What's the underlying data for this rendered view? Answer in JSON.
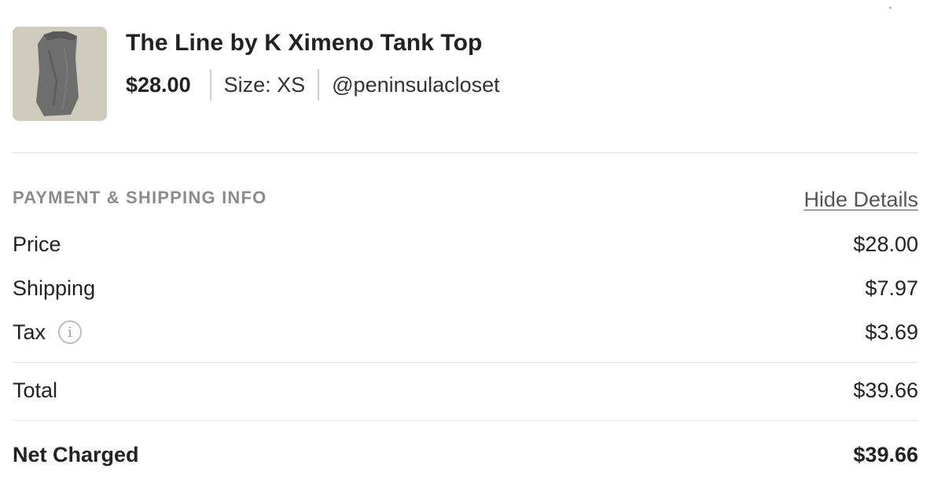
{
  "product": {
    "title": "The Line by K Ximeno Tank Top",
    "price": "$28.00",
    "size": "Size: XS",
    "seller": "@peninsulacloset",
    "thumbnail_icon": "grey-tank-top-photo"
  },
  "payment_section": {
    "label": "PAYMENT & SHIPPING INFO",
    "toggle_label": "Hide Details"
  },
  "breakdown": {
    "price": {
      "label": "Price",
      "value": "$28.00"
    },
    "shipping": {
      "label": "Shipping",
      "value": "$7.97"
    },
    "tax": {
      "label": "Tax",
      "value": "$3.69",
      "info_icon": "info-circle-icon",
      "info_glyph": "i"
    },
    "total": {
      "label": "Total",
      "value": "$39.66"
    },
    "net_charged": {
      "label": "Net Charged",
      "value": "$39.66"
    }
  },
  "colors": {
    "text": "#222222",
    "muted": "#8c8c8c",
    "divider": "#e6e6e6",
    "link": "#555555"
  }
}
